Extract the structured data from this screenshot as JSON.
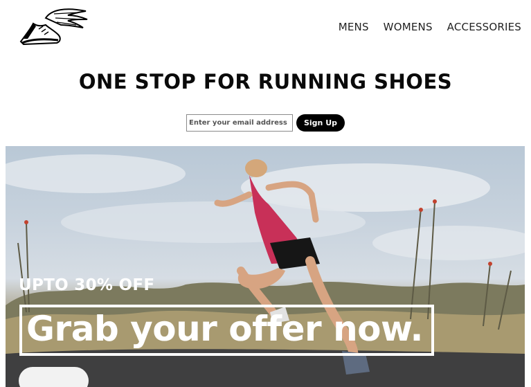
{
  "header": {
    "logo_icon": "winged-shoe-logo",
    "nav": [
      {
        "label": "MENS"
      },
      {
        "label": "WOMENS"
      },
      {
        "label": "ACCESSORIES"
      }
    ]
  },
  "hero": {
    "title": "ONE STOP FOR RUNNING SHOES"
  },
  "signup": {
    "email_placeholder": "Enter your email address",
    "email_value": "",
    "button_label": "Sign Up"
  },
  "banner": {
    "image": "woman-running-on-desert-road",
    "offer_small": "UPTO 30% OFF",
    "offer_big": "Grab your offer now.",
    "cta_label": ""
  },
  "colors": {
    "button_bg": "#000000",
    "text_dark": "#111111",
    "banner_text": "#ffffff"
  }
}
